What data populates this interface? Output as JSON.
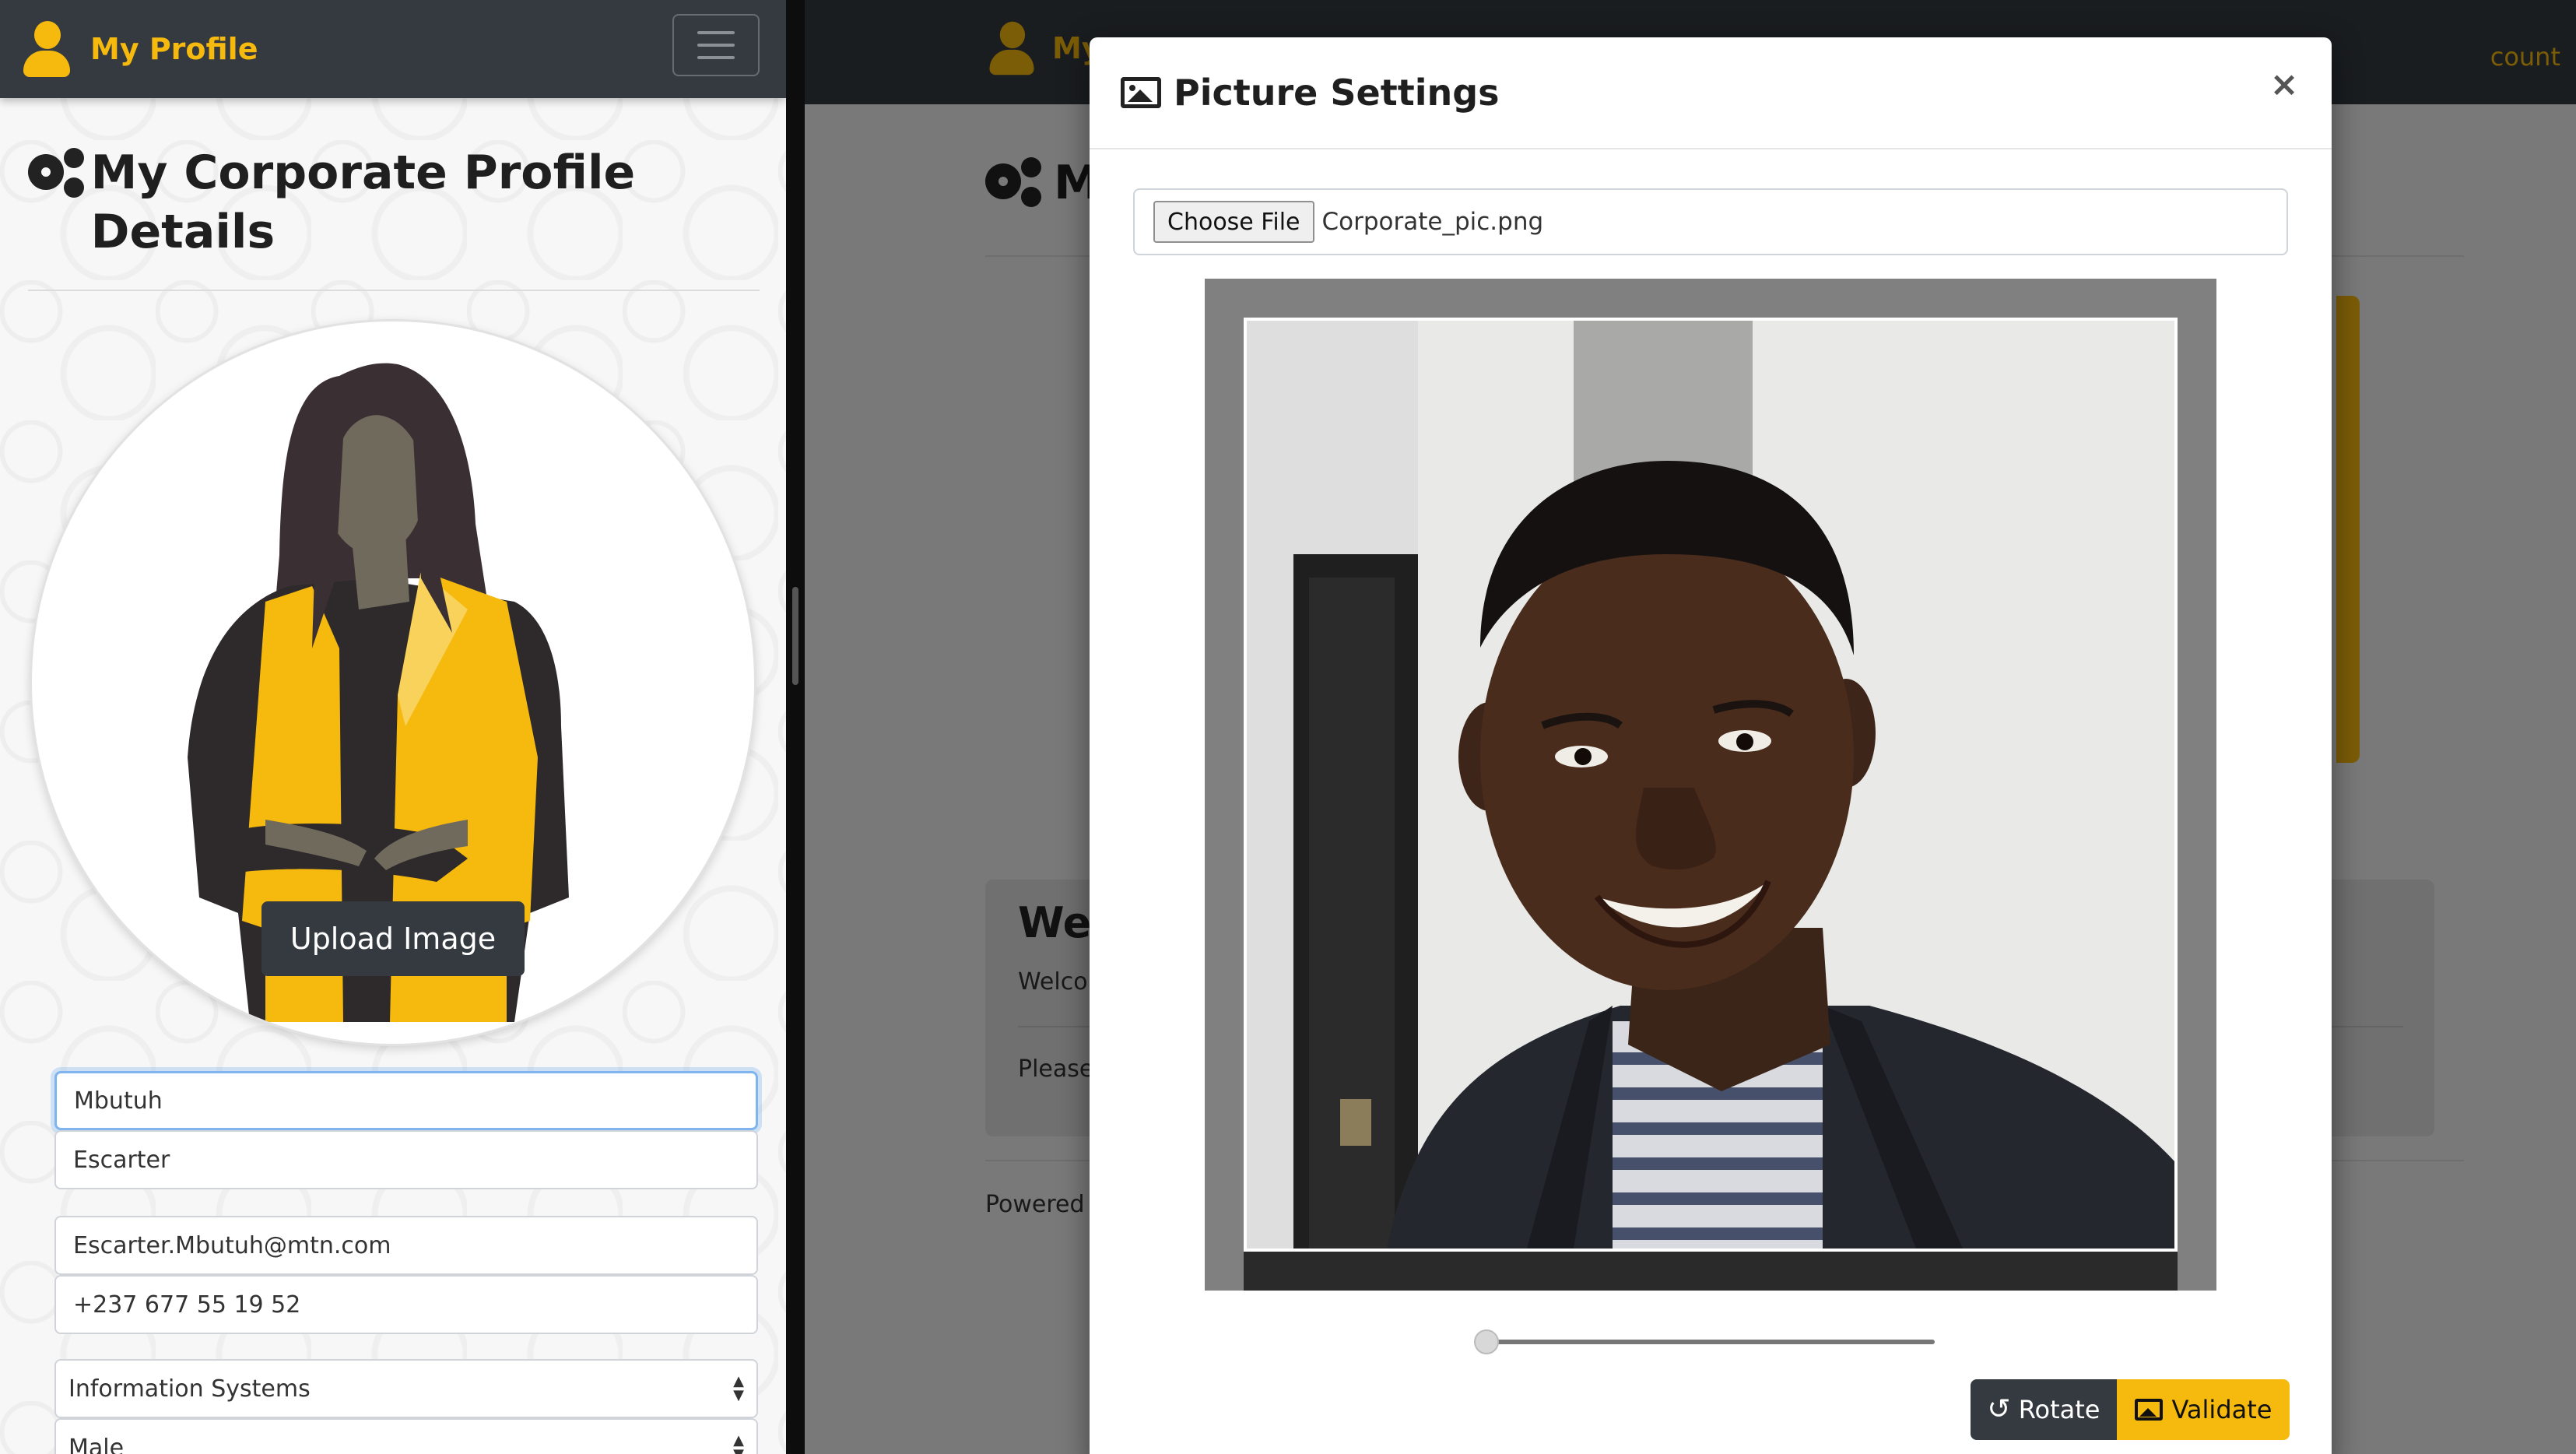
{
  "left": {
    "nav": {
      "brand": "My Profile"
    },
    "page_title": "My Corporate Profile Details",
    "upload_label": "Upload Image",
    "fields": {
      "first_name": "Mbutuh",
      "last_name": "Escarter",
      "email": "Escarter.Mbutuh@mtn.com",
      "phone": "+237 677 55 19 52",
      "department": "Information Systems",
      "gender": "Male"
    }
  },
  "right": {
    "nav": {
      "brand": "My",
      "account": "count"
    },
    "title_fragment": "M",
    "welcome_heading": "Wel",
    "welcome_text": "Welco",
    "please_text": "Please",
    "powered_text": "Powered"
  },
  "modal": {
    "title": "Picture Settings",
    "close_label": "×",
    "choose_file_label": "Choose File",
    "file_name": "Corporate_pic.png",
    "zoom_level": 0,
    "rotate_label": "Rotate",
    "validate_label": "Validate"
  },
  "icons": {
    "brand": "user-icon",
    "menu": "hamburger-icon",
    "title": "cogs-icon",
    "modal_title": "image-icon",
    "rotate": "rotate-icon",
    "validate": "image-icon"
  },
  "colors": {
    "brand_yellow": "#f6b90e",
    "nav_dark": "#343a40",
    "focus_blue": "#80b4ef"
  }
}
